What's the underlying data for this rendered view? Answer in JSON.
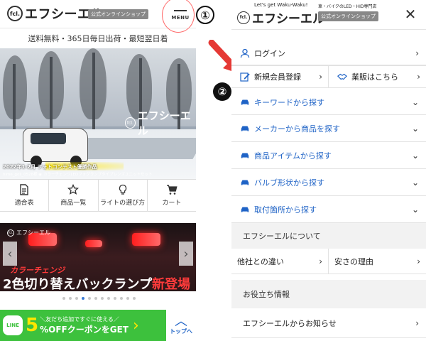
{
  "left": {
    "logo_mark": "fcl.",
    "logo_text": "エフシーエル",
    "shop_badge": "公式オンラインショップ",
    "menu_label": "MENU",
    "shipping": "送料無料・365日毎日出荷・最短翌日着",
    "hero": {
      "logo_mark": "fcl.",
      "logo_text": "エフシーエル",
      "caption": "2022年1-2月 フォトコンテスト優勝作品",
      "subcaption": "hime_goli_0528様 ◉ カラーチェンジLEDフォグランプタイプレンズユニットセット"
    },
    "categories": [
      {
        "label": "適合表",
        "icon": "document-icon"
      },
      {
        "label": "商品一覧",
        "icon": "star-icon"
      },
      {
        "label": "ライトの選び方",
        "icon": "bulb-icon"
      },
      {
        "label": "カート",
        "icon": "cart-icon"
      }
    ],
    "banner": {
      "logo_mark": "fcl.",
      "logo_text": "エフシーエル",
      "sub": "カラーチェンジ",
      "main_prefix": "2色切り替え",
      "main_mid": "バックランプ",
      "main_suffix": "新登場"
    },
    "carousel_total": 12,
    "carousel_active": 3,
    "line_bar": {
      "icon_text": "LINE",
      "percent": "5",
      "top_text": "＼友だち追加ですぐに使える／",
      "bottom_text": "%OFFクーポンをGET"
    },
    "top_button_label": "トップへ"
  },
  "annotations": {
    "one": "①",
    "two": "②"
  },
  "right": {
    "tagline": "Let's get Waku-Waku!",
    "led_text": "車・バイクのLED・HID専門店",
    "logo_mark": "fcl.",
    "logo_text": "エフシーエル",
    "shop_badge": "公式オンラインショップ",
    "login": "ログイン",
    "register": "新規会員登録",
    "wholesale": "業販はこちら",
    "search_items": [
      "キーワードから探す",
      "メーカーから商品を探す",
      "商品アイテムから探す",
      "バルブ形状から探す",
      "取付箇所から探す"
    ],
    "about_heading": "エフシーエルについて",
    "difference": "他社との違い",
    "cheap_reason": "安さの理由",
    "info_heading": "お役立ち情報",
    "news": "エフシーエルからお知らせ"
  },
  "colors": {
    "accent_blue": "#1f63c6",
    "line_green": "#3dc13d",
    "annotation_red": "#e53935"
  }
}
